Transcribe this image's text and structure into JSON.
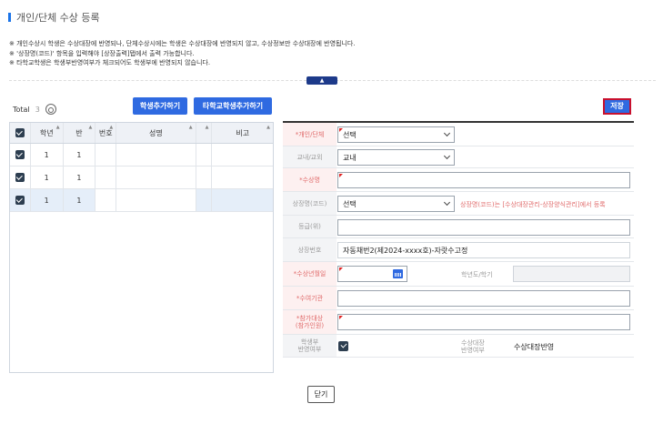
{
  "page": {
    "title": "개인/단체 수상 등록"
  },
  "notes": [
    "※ 개인수상시 학생은 수상대장에 반영되나, 단체수상시에는 학생은 수상대장에 반영되지 않고, 수상정보만 수상대장에 반영됩니다.",
    "※ '상장명(코드)' 항목을 입력해야 [상장출력]탭에서 출력 가능합니다.",
    "※ 타학교학생은 학생부반영여부가 체크되어도 학생부에 반영되지 않습니다."
  ],
  "toggle": {
    "label": "▲"
  },
  "toolbar": {
    "total_label": "Total",
    "total_count": "3",
    "add_student_label": "학생추가하기",
    "add_other_school_label": "타학교학생추가하기",
    "save_label": "저장",
    "close_label": "닫기"
  },
  "grid": {
    "columns": [
      "학년",
      "반",
      "번호",
      "성명",
      "",
      "비고"
    ],
    "rows": [
      {
        "grade": "1",
        "class": "1",
        "number": "",
        "name": "",
        "note": ""
      },
      {
        "grade": "1",
        "class": "1",
        "number": "",
        "name": "",
        "note": ""
      },
      {
        "grade": "1",
        "class": "1",
        "number": "",
        "name": "",
        "note": ""
      }
    ]
  },
  "form": {
    "type_label": "*개인/단체",
    "type_value": "선택",
    "scope_label": "교내/교외",
    "scope_value": "교내",
    "award_label": "*수상명",
    "award_value": "",
    "cert_label": "상장명(코드)",
    "cert_value": "선택",
    "cert_hint": "상장명(코드)는 [수상대장관리-상장양식관리]에서 등록",
    "rank_label": "등급(위)",
    "rank_value": "",
    "number_label": "상장번호",
    "number_value": "자동채번2(제2024-xxxx호)-자랏수고정",
    "date_label": "*수상년월일",
    "date_value": "",
    "year_label": "학년도/학기",
    "year_value": "",
    "org_label": "*수여기관",
    "org_value": "",
    "target_label": "*참가대상\n(참가인원)",
    "target_value": "",
    "reflect_label": "학생부\n반영여부",
    "ledger_label": "수상대장\n반영여부",
    "ledger_value": "수상대장반영"
  },
  "colors": {
    "accent": "#2f6ae1",
    "required": "#e06a6a",
    "save_border": "#c8102e"
  }
}
